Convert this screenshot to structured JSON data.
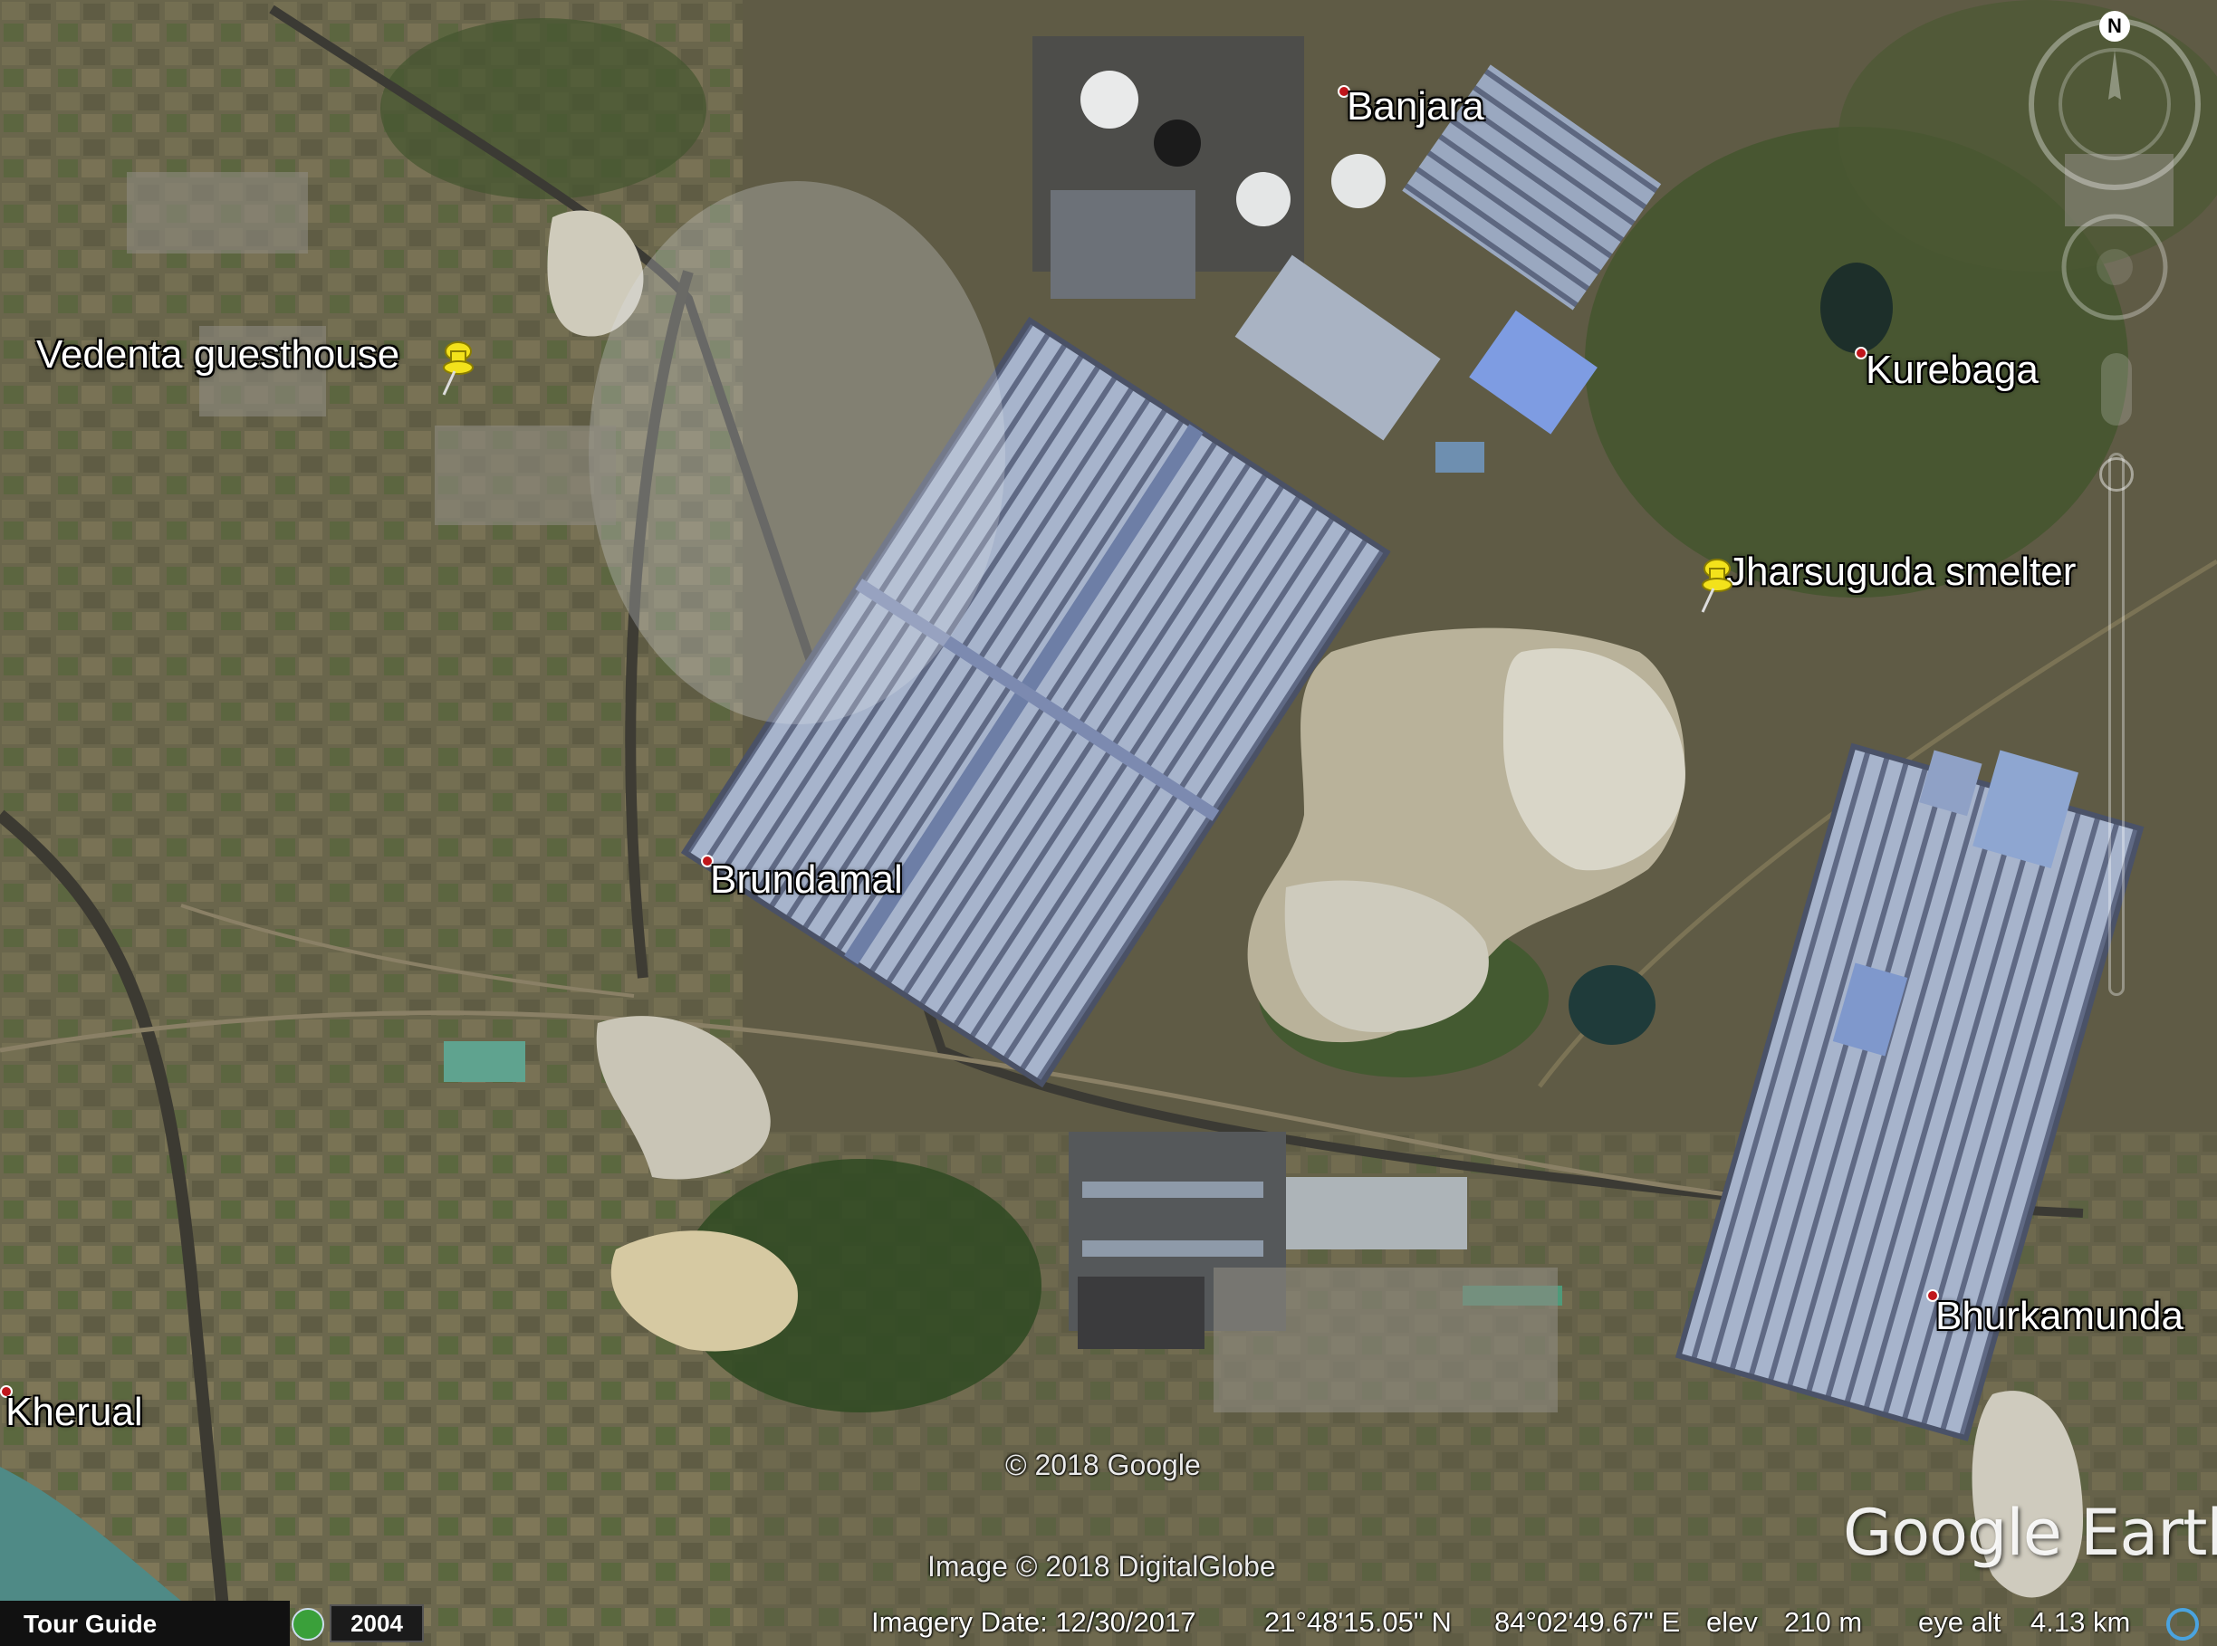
{
  "places": [
    {
      "name": "Banjara"
    },
    {
      "name": "Kurebaga"
    },
    {
      "name": "Brundamal"
    },
    {
      "name": "Bhurkamunda"
    },
    {
      "name": "Kherual"
    }
  ],
  "placemarks": [
    {
      "name": "Vedenta guesthouse"
    },
    {
      "name": "Jharsuguda smelter"
    }
  ],
  "attribution": {
    "copyright": "© 2018 Google",
    "imagery_credit": "Image © 2018 DigitalGlobe",
    "brand": "Google Earth"
  },
  "navigation": {
    "north_label": "N"
  },
  "status_bar": {
    "tour_guide": "Tour Guide",
    "year": "2004",
    "imagery_date": "Imagery Date: 12/30/2017",
    "latitude": "21°48'15.05\" N",
    "longitude": "84°02'49.67\" E",
    "elev_label": "elev",
    "elev_value": "210 m",
    "eye_alt_label": "eye alt",
    "eye_alt_value": "4.13 km"
  },
  "colors": {
    "place_dot": "#c0161b",
    "pushpin": "#f3e21b"
  }
}
